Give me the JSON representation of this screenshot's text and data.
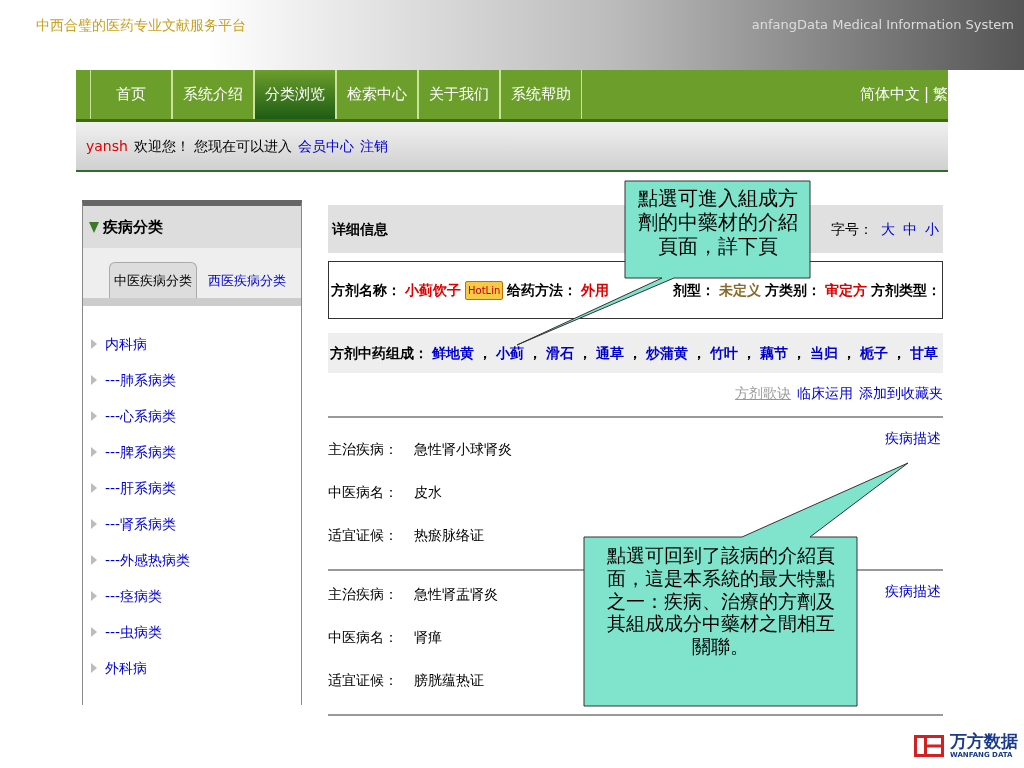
{
  "slide_header": {
    "title": "中西合璧的医药专业文献服务平台",
    "subtitle": "anfangData Medical Information System"
  },
  "nav": {
    "items": [
      {
        "label": "首页",
        "selected": false
      },
      {
        "label": "系统介绍",
        "selected": false
      },
      {
        "label": "分类浏览",
        "selected": true
      },
      {
        "label": "检索中心",
        "selected": false
      },
      {
        "label": "关于我们",
        "selected": false
      },
      {
        "label": "系统帮助",
        "selected": false
      }
    ],
    "languages": [
      "简体中文",
      "繁"
    ],
    "language_divider": "|"
  },
  "welcome": {
    "user": "yansh",
    "text": "欢迎您！ 您现在可以进入",
    "links": [
      "会员中心",
      "注销"
    ]
  },
  "sidebar": {
    "title": "疾病分类",
    "tabs": [
      {
        "label": "中医疾病分类",
        "selected": true
      },
      {
        "label": "西医疾病分类",
        "selected": false
      }
    ],
    "items": [
      "内科病",
      "---肺系病类",
      "---心系病类",
      "---脾系病类",
      "---肝系病类",
      "---肾系病类",
      "---外感热病类",
      "---痉病类",
      "---虫病类",
      "外科病"
    ]
  },
  "detail": {
    "title": "详细信息",
    "font_size_label": "字号：",
    "font_sizes": [
      "大",
      "中",
      "小"
    ],
    "fields": [
      {
        "label": "方剂名称：",
        "value": "小蓟饮子",
        "color": "#dd0000",
        "badge": "HotLin"
      },
      {
        "label": "给药方法：",
        "value": "外用",
        "color": "#dd0000"
      },
      {
        "label": "剂型：",
        "value": "未定义",
        "color": "#8a6a2a"
      },
      {
        "label": "方类别：",
        "value": "审定方",
        "color": "#dd0000"
      },
      {
        "label": "方剂类型："
      }
    ],
    "ingredients_label": "方剂中药组成：",
    "ingredient_separator": "，",
    "ingredients": [
      "鲜地黄",
      "小蓟",
      "滑石",
      "通草",
      "炒蒲黄",
      "竹叶",
      "藕节",
      "当归",
      "栀子",
      "甘草"
    ],
    "links": [
      {
        "label": "方剂歌诀",
        "disabled": true
      },
      {
        "label": "临床运用",
        "disabled": false
      },
      {
        "label": "添加到收藏夹",
        "disabled": false
      }
    ],
    "diseases": [
      {
        "rows": [
          {
            "label": "主治疾病：",
            "value": "急性肾小球肾炎"
          },
          {
            "label": "中医病名：",
            "value": "皮水"
          },
          {
            "label": "适宜证候：",
            "value": "热瘀脉络证"
          }
        ],
        "link": "疾病描述"
      },
      {
        "rows": [
          {
            "label": "主治疾病：",
            "value": "急性肾盂肾炎"
          },
          {
            "label": "中医病名：",
            "value": "肾瘅"
          },
          {
            "label": "适宜证候：",
            "value": "膀胱蕴热证"
          }
        ],
        "link": "疾病描述"
      }
    ]
  },
  "callouts": [
    {
      "text": "點選可進入組成方劑的中藥材的介紹頁面，詳下頁"
    },
    {
      "text": "點選可回到了該病的介紹頁面，這是本系統的最大特點之一：疾病、治療的方劑及其組成成分中藥材之間相互關聯。"
    }
  ],
  "logo": {
    "name": "万方数据",
    "tagline": "WANFANG DATA"
  }
}
